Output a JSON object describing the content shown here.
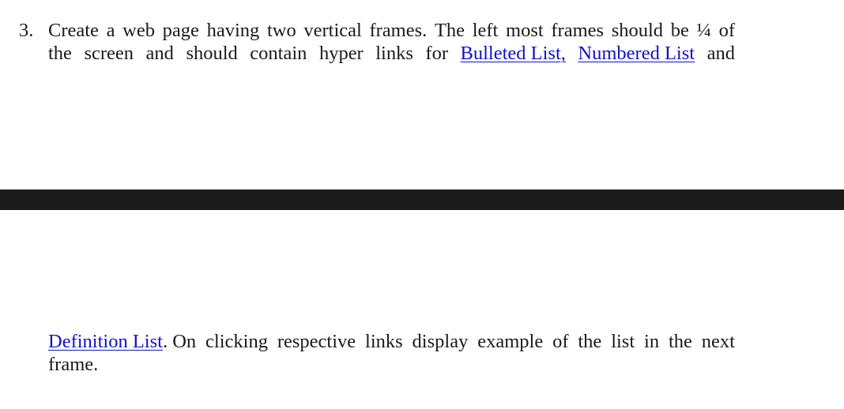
{
  "item": {
    "number": "3.",
    "line1": [
      "Create",
      "a",
      "web",
      "page",
      "having",
      "two",
      "vertical",
      "frames.",
      "The",
      "left",
      "most",
      "frames",
      "should",
      "be",
      "¼",
      "of"
    ],
    "line2_words": [
      "the",
      "screen",
      "and",
      "should",
      "contain",
      "hyper",
      "links",
      "for"
    ],
    "link_bulleted": "Bulleted List,",
    "link_numbered": "Numbered List",
    "line2_end": "and",
    "link_definition": "Definition List",
    "line3_rest": [
      ". On",
      "clicking",
      "respective",
      "links",
      "display",
      "example",
      "of",
      "the",
      "list",
      "in",
      "the",
      "next"
    ],
    "line4": "frame."
  }
}
